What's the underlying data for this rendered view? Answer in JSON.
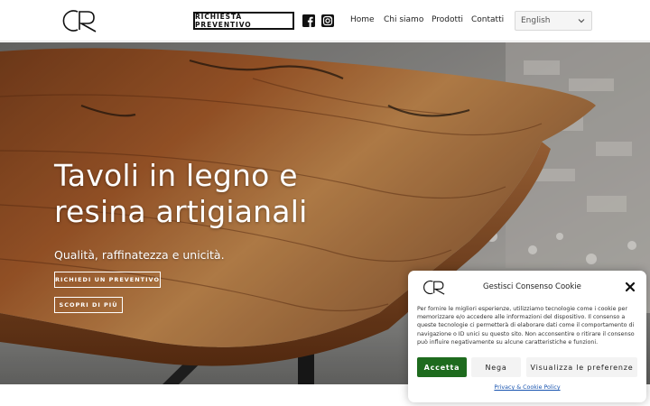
{
  "header": {
    "logo_text": "CR",
    "quote_button": "RICHIESTA PREVENTIVO",
    "social": [
      "facebook-icon",
      "instagram-icon"
    ],
    "nav": {
      "home": "Home",
      "about": "Chi siamo",
      "products": "Prodotti",
      "contacts": "Contatti"
    },
    "language": {
      "selected": "English",
      "icon": "chevron-down-icon"
    }
  },
  "hero": {
    "title_line1": "Tavoli in legno e",
    "title_line2": "resina artigianali",
    "subtitle": "Qualità, raffinatezza e unicità.",
    "quote_button": "RICHIEDI UN PREVENTIVO",
    "discover_button": "SCOPRI DI PIÙ"
  },
  "cookie": {
    "title": "Gestisci Consenso Cookie",
    "text": "Per fornire le migliori esperienze, utilizziamo tecnologie come i cookie per memorizzare e/o accedere alle informazioni del dispositivo. Il consenso a queste tecnologie ci permetterà di elaborare dati come il comportamento di navigazione o ID unici su questo sito. Non acconsentire o ritirare il consenso può influire negativamente su alcune caratteristiche e funzioni.",
    "accept": "Accetta",
    "deny": "Nega",
    "preferences": "Visualizza le preferenze",
    "policy_link": "Privacy & Cookie Policy"
  },
  "colors": {
    "accent_green": "#1e6b1e",
    "link_blue": "#1a55b0",
    "wood": "#8a4a22"
  }
}
